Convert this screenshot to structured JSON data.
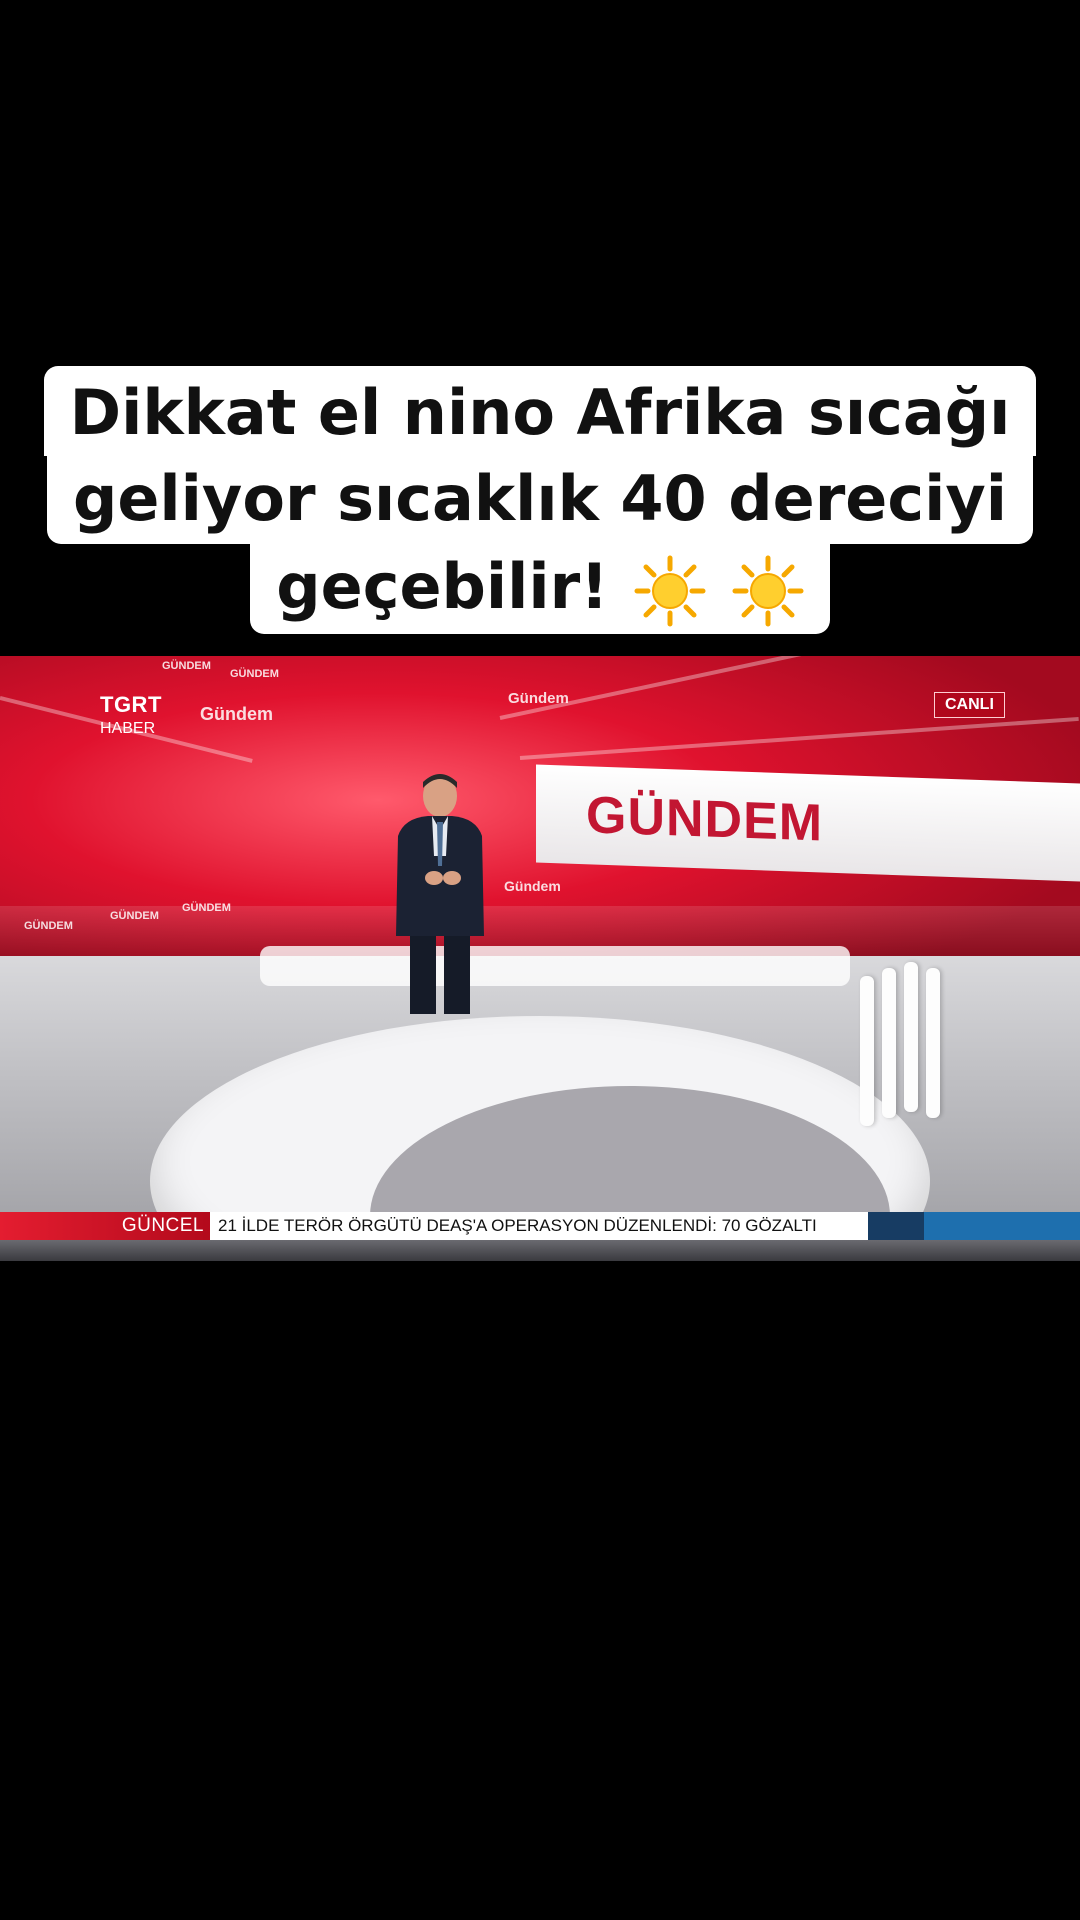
{
  "caption": {
    "line1": "Dikkat el nino Afrika sıcağı",
    "line2": "geliyor sıcaklık 40 dereciyi",
    "line3": "geçebilir!",
    "emoji": [
      "sun-icon",
      "sun-icon"
    ]
  },
  "video": {
    "channel_logo": "TGRT",
    "channel_logo_sub": "HABER",
    "live_badge": "CANLI",
    "program_banner": "GÜNDEM",
    "wall_labels": [
      "GÜNDEM",
      "GÜNDEM",
      "Gündem",
      "Gündem",
      "Gündem",
      "GÜNDEM",
      "GÜNDEM",
      "GÜNDEM"
    ],
    "ticker": {
      "category": "GÜNCEL",
      "headline": "21 İLDE TERÖR ÖRGÜTÜ DEAŞ'A OPERASYON DÜZENLENDİ: 70 GÖZALTI"
    }
  },
  "colors": {
    "background": "#000000",
    "caption_bg": "#ffffff",
    "studio_red": "#c8102e",
    "ticker_red": "#e41d30",
    "ticker_blue": "#1e6fae"
  }
}
